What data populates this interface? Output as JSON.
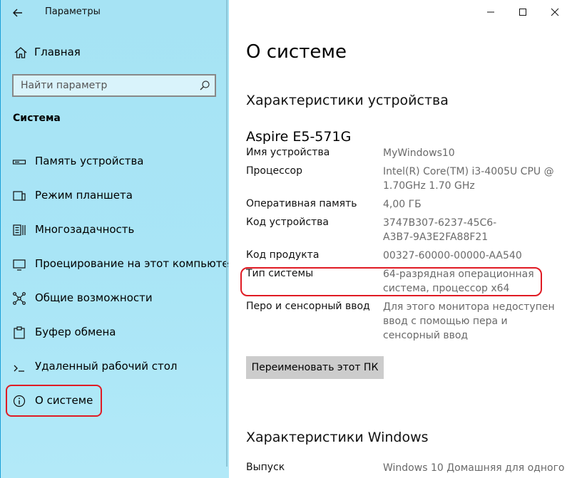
{
  "app": {
    "title": "Параметры"
  },
  "sidebar": {
    "home_label": "Главная",
    "search_placeholder": "Найти параметр",
    "section_label": "Система",
    "items": [
      {
        "label": "Память устройства",
        "icon": "storage-icon"
      },
      {
        "label": "Режим планшета",
        "icon": "tablet-mode-icon"
      },
      {
        "label": "Многозадачность",
        "icon": "multitasking-icon"
      },
      {
        "label": "Проецирование на этот компьютер",
        "icon": "projecting-icon"
      },
      {
        "label": "Общие возможности",
        "icon": "shared-experiences-icon"
      },
      {
        "label": "Буфер обмена",
        "icon": "clipboard-icon"
      },
      {
        "label": "Удаленный рабочий стол",
        "icon": "remote-desktop-icon"
      },
      {
        "label": "О системе",
        "icon": "info-icon",
        "selected": true
      }
    ]
  },
  "content": {
    "page_title": "О системе",
    "device_section_title": "Характеристики устройства",
    "device_model": "Aspire E5-571G",
    "specs": [
      {
        "key": "Имя устройства",
        "value": "MyWindows10"
      },
      {
        "key": "Процессор",
        "value": [
          "Intel(R) Core(TM) i3-4005U CPU @",
          "1.70GHz   1.70 GHz"
        ]
      },
      {
        "key": "Оперативная память",
        "value": "4,00 ГБ"
      },
      {
        "key": "Код устройства",
        "value": [
          "3747B307-6237-45C6-",
          "A3B7-9A3E2FA88F21"
        ]
      },
      {
        "key": "Код продукта",
        "value": "00327-60000-00000-AA540"
      },
      {
        "key": "Тип системы",
        "value": [
          "64-разрядная операционная",
          "система, процессор x64"
        ],
        "highlighted": true
      },
      {
        "key": "Перо и сенсорный ввод",
        "value": [
          "Для этого монитора недоступен",
          "ввод с помощью пера и",
          "сенсорный ввод"
        ]
      }
    ],
    "rename_button": "Переименовать этот ПК",
    "windows_section_title": "Характеристики Windows",
    "edition_key": "Выпуск",
    "edition_value": "Windows 10 Домашняя для одного"
  },
  "colors": {
    "sidebar_bg": "#a8e4f5",
    "highlight": "#e01b24",
    "value_text": "#6a6a6a",
    "button_bg": "#cccccc"
  }
}
